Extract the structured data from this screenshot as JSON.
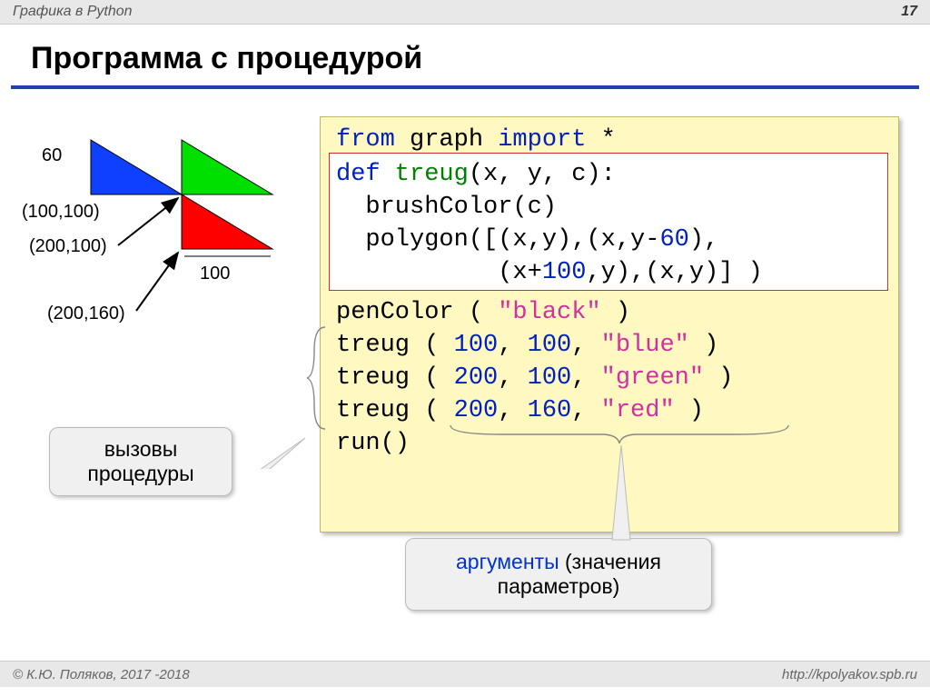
{
  "header": {
    "breadcrumb": "Графика в Python",
    "page_number": "17"
  },
  "title": "Программа с процедурой",
  "diagram": {
    "height_label": "60",
    "point1": "(100,100)",
    "point2": "(200,100)",
    "point3": "(200,160)",
    "width_label": "100"
  },
  "code": {
    "l1_from": "from",
    "l1_graph": " graph ",
    "l1_import": "import",
    "l1_star": " *",
    "l2_def": "def",
    "l2_name": " treug",
    "l2_sig": "(x, y, c):",
    "l3": "  brushColor(c)",
    "l4a": "  polygon([(x,y),(x,y-",
    "l4_num": "60",
    "l4b": "),",
    "l5a": "           (x+",
    "l5_num": "100",
    "l5b": ",y),(x,y)] )",
    "l6a": "penColor ( ",
    "l6_str": "\"black\"",
    "l6b": " )",
    "l7a": "treug ( ",
    "l7_n1": "100",
    "l7_c": ", ",
    "l7_n2": "100",
    "l7_c2": ", ",
    "l7_s": "\"blue\"",
    "l7b": " )",
    "l8a": "treug ( ",
    "l8_n1": "200",
    "l8_c": ", ",
    "l8_n2": "100",
    "l8_c2": ", ",
    "l8_s": "\"green\"",
    "l8b": " )",
    "l9a": "treug ( ",
    "l9_n1": "200",
    "l9_c": ", ",
    "l9_n2": "160",
    "l9_c2": ", ",
    "l9_s": "\"red\"",
    "l9b": " )",
    "l10": "run()"
  },
  "callouts": {
    "calls_l1": "вызовы",
    "calls_l2": "процедуры",
    "args_l1": "аргументы ",
    "args_l2a": "(значения",
    "args_l2b": "параметров)"
  },
  "footer": {
    "left": "© К.Ю. Поляков, 2017 -2018",
    "right": "http://kpolyakov.spb.ru"
  }
}
